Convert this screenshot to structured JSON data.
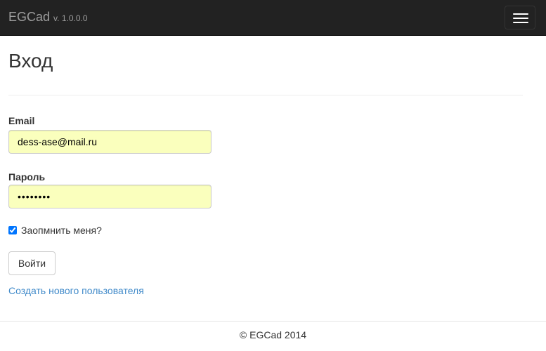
{
  "navbar": {
    "brand": "EGCad",
    "version": "v. 1.0.0.0",
    "toggle_icon": "hamburger-menu-icon"
  },
  "page": {
    "title": "Вход"
  },
  "form": {
    "email_label": "Email",
    "email_value": "dess-ase@mail.ru",
    "password_label": "Пароль",
    "password_value": "password",
    "remember_label": "Заопмнить меня?",
    "remember_checked": true,
    "submit_label": "Войти",
    "field_autofill_color": "#faffbd"
  },
  "links": {
    "register": "Создать нового пользователя"
  },
  "footer": {
    "copyright": "© EGCad 2014"
  },
  "colors": {
    "navbar_bg": "#222222",
    "link": "#428bca"
  }
}
